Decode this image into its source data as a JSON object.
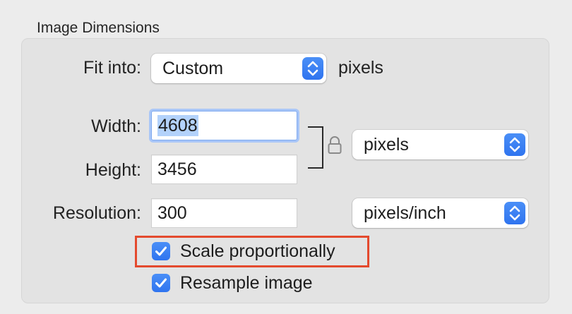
{
  "section": {
    "title": "Image Dimensions"
  },
  "fit_into": {
    "label": "Fit into:",
    "value": "Custom",
    "unit": "pixels"
  },
  "width": {
    "label": "Width:",
    "value": "4608"
  },
  "height": {
    "label": "Height:",
    "value": "3456"
  },
  "dimension_unit": {
    "value": "pixels"
  },
  "resolution": {
    "label": "Resolution:",
    "value": "300",
    "unit": "pixels/inch"
  },
  "checkboxes": [
    {
      "label": "Scale proportionally",
      "checked": true,
      "highlighted": true
    },
    {
      "label": "Resample image",
      "checked": true,
      "highlighted": false
    }
  ],
  "colors": {
    "accent": "#3b82f6",
    "highlight_border": "#e44a2e",
    "selection": "#b3d2fb",
    "focus_ring": "#a9c6f7"
  },
  "icons": {
    "lock": "lock-icon",
    "stepper": "chevron-updown-icon",
    "checkmark": "checkmark-icon"
  }
}
